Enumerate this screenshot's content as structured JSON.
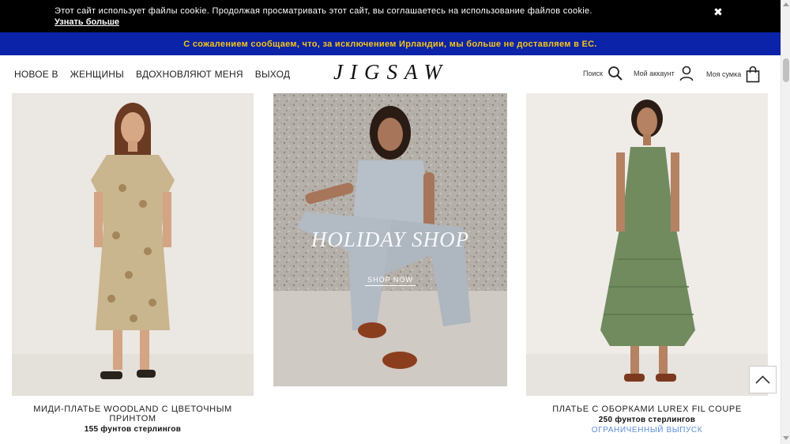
{
  "cookie_bar": {
    "text": "Этот сайт использует файлы cookie. Продолжая просматривать этот сайт, вы соглашаетесь на использование файлов cookie.",
    "link": "Узнать больше",
    "close": "✖"
  },
  "notice": {
    "text": "С сожалением сообщаем, что, за исключением Ирландии, мы больше не доставляем в ЕС."
  },
  "header": {
    "nav": [
      "НОВОЕ В",
      "ЖЕНЩИНЫ",
      "ВДОХНОВЛЯЮТ МЕНЯ",
      "ВЫХОД"
    ],
    "logo": "JIGSAW",
    "search_label": "Поиск",
    "account_label": "Мой аккаунт",
    "bag_label": "Моя сумка"
  },
  "products": [
    {
      "name": "МИДИ-ПЛАТЬЕ WOODLAND С ЦВЕТОЧНЫМ ПРИНТОМ",
      "price": "155 фунтов стерлингов",
      "badge": ""
    },
    {
      "name": "ПЛАТЬЕ С ОБОРКАМИ LUREX FIL COUPE",
      "price": "250 фунтов стерлингов",
      "badge": "ОГРАНИЧЕННЫЙ ВЫПУСК"
    }
  ],
  "promo": {
    "title": "HOLIDAY SHOP",
    "cta": "SHOP NOW"
  },
  "colors": {
    "cookie_bg": "#000000",
    "notice_bg": "#0b23a8",
    "notice_text": "#f5c518",
    "badge_text": "#5b8ed8"
  }
}
